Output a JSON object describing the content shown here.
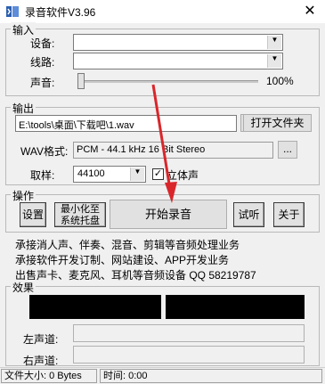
{
  "window": {
    "title": "录音软件V3.96",
    "close_glyph": "✕"
  },
  "input_group": {
    "title": "输入",
    "device_label": "设备:",
    "line_label": "线路:",
    "volume_label": "声音:",
    "volume_text": "100%",
    "volume_level": 0.0
  },
  "output_group": {
    "title": "输出",
    "path_value": "E:\\tools\\桌面\\下载吧\\1.wav",
    "browse_label": "...",
    "open_folder_label": "打开文件夹",
    "wav_format_label": "WAV格式:",
    "wav_format_value": "PCM - 44.1 kHz 16 Bit Stereo",
    "format_browse_label": "...",
    "sample_label": "取样:",
    "sample_value": "44100",
    "stereo_label": "立体声",
    "stereo_checked": true
  },
  "operate_group": {
    "title": "操作",
    "settings_label": "设置",
    "minimize_tray_label_1": "最小化至",
    "minimize_tray_label_2": "系统托盘",
    "start_record_label": "开始录音",
    "audition_label": "试听",
    "about_label": "关于"
  },
  "info_lines": [
    "承接消人声、伴奏、混音、剪辑等音频处理业务",
    "承接软件开发订制、网站建设、APP开发业务",
    "出售声卡、麦克风、耳机等音频设备 QQ 58219787"
  ],
  "effect_group": {
    "title": "效果",
    "left_channel_label": "左声道:",
    "right_channel_label": "右声道:"
  },
  "status": {
    "file_size": "文件大小: 0 Bytes",
    "time": "时间: 0:00"
  },
  "colors": {
    "annotation_arrow": "#d9262b",
    "meter": "#000000"
  }
}
